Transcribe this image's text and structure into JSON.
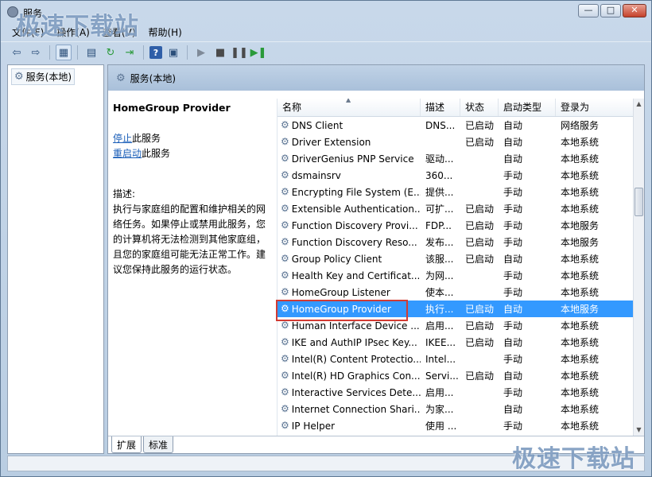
{
  "window": {
    "title": "服务",
    "minimize_label": "—",
    "maximize_label": "□",
    "close_label": "✕"
  },
  "menu": [
    "文件(F)",
    "操作(A)",
    "查看(V)",
    "帮助(H)"
  ],
  "navpane": {
    "item": "服务(本地)"
  },
  "main": {
    "header": "服务(本地)",
    "selected_service": "HomeGroup Provider",
    "stop_link": "停止",
    "stop_suffix": "此服务",
    "restart_link": "重启动",
    "restart_suffix": "此服务",
    "desc_label": "描述:",
    "desc_text": "执行与家庭组的配置和维护相关的网络任务。如果停止或禁用此服务，您的计算机将无法检测到其他家庭组，且您的家庭组可能无法正常工作。建议您保持此服务的运行状态。"
  },
  "columns": [
    "名称",
    "描述",
    "状态",
    "启动类型",
    "登录为"
  ],
  "rows": [
    [
      "DNS Client",
      "DNS...",
      "已启动",
      "自动",
      "网络服务"
    ],
    [
      "Driver Extension",
      "",
      "已启动",
      "自动",
      "本地系统"
    ],
    [
      "DriverGenius PNP Service",
      "驱动...",
      "",
      "自动",
      "本地系统"
    ],
    [
      "dsmainsrv",
      "360...",
      "",
      "手动",
      "本地系统"
    ],
    [
      "Encrypting File System (E...",
      "提供...",
      "",
      "手动",
      "本地系统"
    ],
    [
      "Extensible Authentication...",
      "可扩...",
      "已启动",
      "手动",
      "本地系统"
    ],
    [
      "Function Discovery Provi...",
      "FDP...",
      "已启动",
      "手动",
      "本地服务"
    ],
    [
      "Function Discovery Reso...",
      "发布...",
      "已启动",
      "手动",
      "本地服务"
    ],
    [
      "Group Policy Client",
      "该服...",
      "已启动",
      "自动",
      "本地系统"
    ],
    [
      "Health Key and Certificat...",
      "为网...",
      "",
      "手动",
      "本地系统"
    ],
    [
      "HomeGroup Listener",
      "使本...",
      "",
      "手动",
      "本地系统"
    ],
    [
      "HomeGroup Provider",
      "执行...",
      "已启动",
      "自动",
      "本地服务"
    ],
    [
      "Human Interface Device ...",
      "启用...",
      "已启动",
      "手动",
      "本地系统"
    ],
    [
      "IKE and AuthIP IPsec Key...",
      "IKEE...",
      "已启动",
      "自动",
      "本地系统"
    ],
    [
      "Intel(R) Content Protectio...",
      "Intel...",
      "",
      "手动",
      "本地系统"
    ],
    [
      "Intel(R) HD Graphics Con...",
      "Servi...",
      "已启动",
      "自动",
      "本地系统"
    ],
    [
      "Interactive Services Dete...",
      "启用...",
      "",
      "手动",
      "本地系统"
    ],
    [
      "Internet Connection Shari...",
      "为家...",
      "",
      "自动",
      "本地系统"
    ],
    [
      "IP Helper",
      "使用 ...",
      "",
      "手动",
      "本地系统"
    ]
  ],
  "selected_row_index": 11,
  "tabs": [
    "扩展",
    "标准"
  ],
  "watermark": "极速下载站",
  "colors": {
    "selection": "#3399ff",
    "highlight": "#d23b33",
    "header": "#a9c0da"
  }
}
